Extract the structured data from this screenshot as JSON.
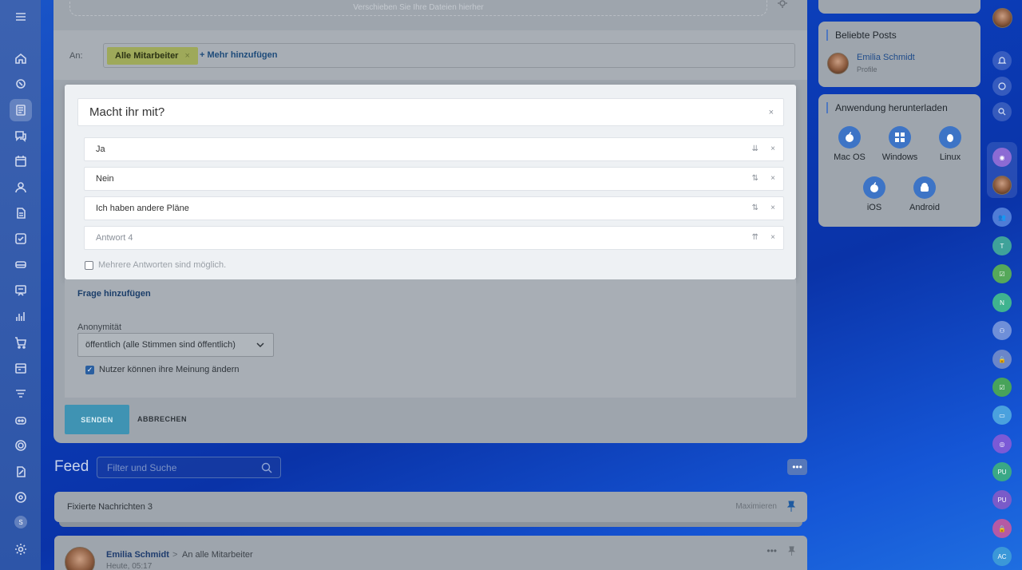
{
  "composer": {
    "drop_hint": "Verschieben Sie Ihre Dateien hierher",
    "to_label": "An:",
    "recipient_chip": "Alle Mitarbeiter",
    "chip_remove": "×",
    "add_more": "+ Mehr hinzufügen"
  },
  "poll": {
    "question": "Macht ihr mit?",
    "close": "×",
    "answers": [
      {
        "text": "Ja",
        "sort": "⇊",
        "del": "×"
      },
      {
        "text": "Nein",
        "sort": "⇅",
        "del": "×"
      },
      {
        "text": "Ich haben andere Pläne",
        "sort": "⇅",
        "del": "×"
      },
      {
        "placeholder": "Antwort  4",
        "sort": "⇈",
        "del": "×"
      }
    ],
    "multiple_label": "Mehrere Antworten sind möglich.",
    "add_question": "Frage hinzufügen",
    "anonymity_label": "Anonymität",
    "anonymity_value": "öffentlich (alle Stimmen sind öffentlich)",
    "change_label": "Nutzer können ihre Meinung ändern"
  },
  "actions": {
    "send": "SENDEN",
    "cancel": "ABBRECHEN"
  },
  "feed": {
    "title": "Feed",
    "search_placeholder": "Filter und Suche",
    "more": "•••",
    "pinned_label": "Fixierte Nachrichten",
    "pinned_count": "3",
    "maximize": "Maximieren",
    "post": {
      "author": "Emilia Schmidt",
      "separator": ">",
      "target": "An alle Mitarbeiter",
      "time": "Heute, 05:17",
      "dots": "•••"
    }
  },
  "widgets": {
    "popular_title": "Beliebte Posts",
    "popular_name": "Emilia Schmidt",
    "popular_sub": "Profile",
    "download_title": "Anwendung herunterladen",
    "apps": [
      "Mac OS",
      "Windows",
      "Linux",
      "iOS",
      "Android"
    ]
  },
  "right_rail": {
    "t": "T",
    "n": "N",
    "pu1": "PU",
    "pu2": "PU",
    "ac": "AC"
  },
  "left_rail": {
    "bubble": "S"
  },
  "colors": {
    "accent": "#3f93b3",
    "link": "#1e4b7a",
    "chip": "#9ea95a",
    "background": "#0b3db8"
  }
}
